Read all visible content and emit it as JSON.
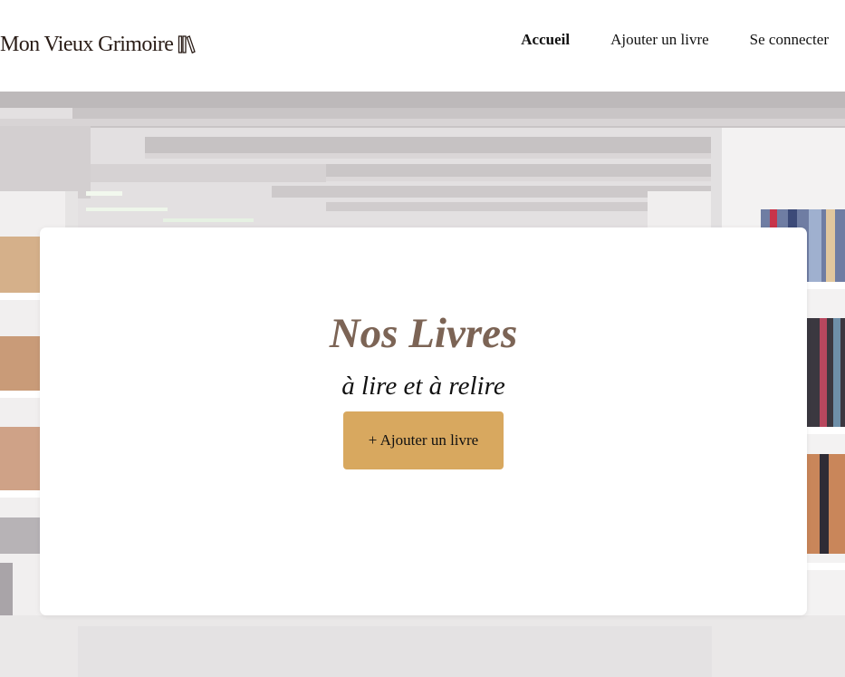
{
  "header": {
    "logo_text": "Mon Vieux Grimoire",
    "logo_icon": "books-icon",
    "nav": [
      {
        "label": "Accueil",
        "active": true
      },
      {
        "label": "Ajouter un livre",
        "active": false
      },
      {
        "label": "Se connecter",
        "active": false
      }
    ]
  },
  "hero": {
    "background_image": "library-shelves-photo",
    "title": "Nos Livres",
    "subtitle": "à lire et à relire",
    "add_button_label": "+ Ajouter un livre"
  },
  "colors": {
    "title": "#7c6455",
    "button": "#d8a85f",
    "logo": "#2a1d17"
  }
}
